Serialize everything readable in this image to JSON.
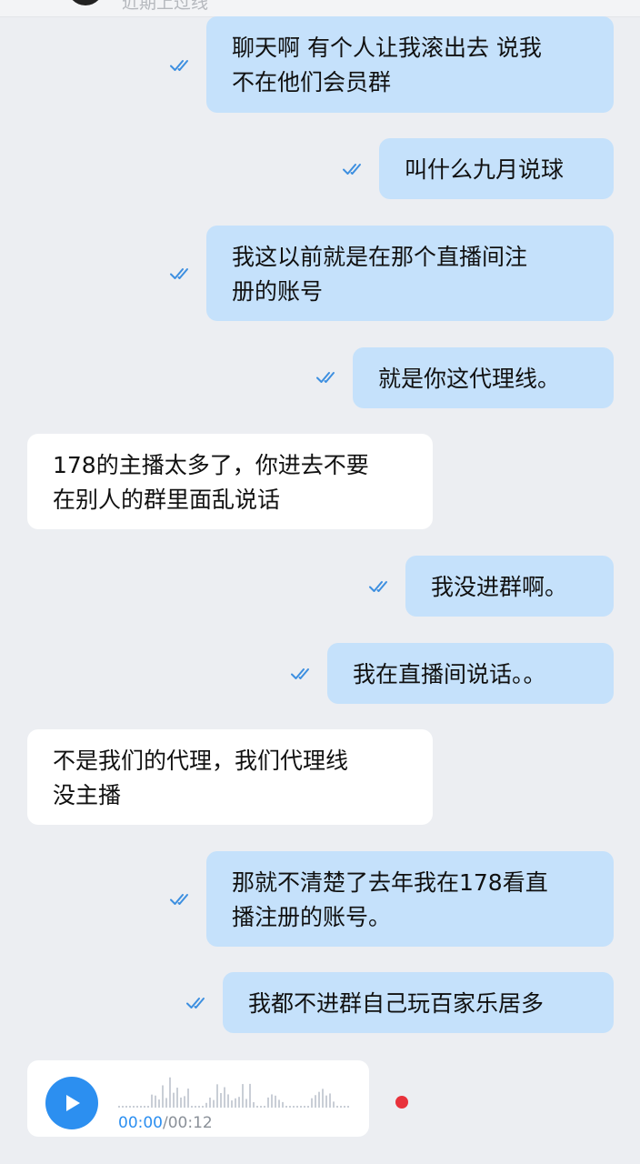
{
  "header": {
    "status": "近期上过线"
  },
  "messages": [
    {
      "direction": "out",
      "line1": "聊天啊 有个人让我滚出去 说我",
      "line2": "不在他们会员群",
      "read": true
    },
    {
      "direction": "out",
      "line1": "叫什么九月说球",
      "read": true
    },
    {
      "direction": "out",
      "line1": "我这以前就是在那个直播间注",
      "line2": "册的账号",
      "read": true
    },
    {
      "direction": "out",
      "line1": "就是你这代理线。",
      "read": true
    },
    {
      "direction": "in",
      "line1": "178的主播太多了，你进去不要",
      "line2": "在别人的群里面乱说话"
    },
    {
      "direction": "out",
      "line1": "我没进群啊。",
      "read": true
    },
    {
      "direction": "out",
      "line1": "我在直播间说话。。",
      "read": true
    },
    {
      "direction": "in",
      "line1": "不是我们的代理，我们代理线",
      "line2": "没主播"
    },
    {
      "direction": "out",
      "line1": "那就不清楚了去年我在178看直",
      "line2": "播注册的账号。",
      "read": true
    },
    {
      "direction": "out",
      "line1": "我都不进群自己玩百家乐居多",
      "read": true
    }
  ],
  "voice_message": {
    "current_time": "00:00",
    "separator": "/",
    "duration": "00:12",
    "unread": true
  },
  "colors": {
    "outgoing_bubble": "#c5e1fb",
    "incoming_bubble": "#ffffff",
    "background": "#eceef2",
    "read_check": "#3d8fe0",
    "play_button": "#2c8ff0",
    "unread_dot": "#e8323c"
  },
  "icons": {
    "read_receipt": "double-check-icon",
    "play": "play-icon"
  }
}
